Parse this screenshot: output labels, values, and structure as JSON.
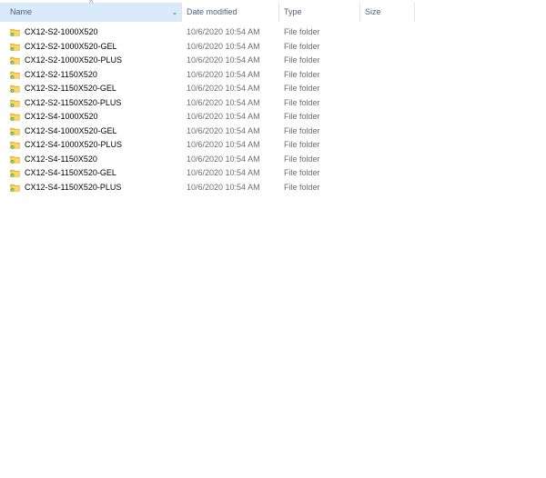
{
  "columns": {
    "name": "Name",
    "date_modified": "Date modified",
    "type": "Type",
    "size": "Size"
  },
  "icons": {
    "sort": "sort-up-icon",
    "dropdown": "chevron-down-icon",
    "folder": "folder-sync-icon"
  },
  "colors": {
    "header_selected_bg": "#d9ebf9",
    "folder_yellow": "#f3c54b",
    "sync_green": "#55b23a"
  },
  "files": [
    {
      "name": "CX12-S2-1000X520",
      "date": "10/6/2020 10:54 AM",
      "type": "File folder",
      "size": ""
    },
    {
      "name": "CX12-S2-1000X520-GEL",
      "date": "10/6/2020 10:54 AM",
      "type": "File folder",
      "size": ""
    },
    {
      "name": "CX12-S2-1000X520-PLUS",
      "date": "10/6/2020 10:54 AM",
      "type": "File folder",
      "size": ""
    },
    {
      "name": "CX12-S2-1150X520",
      "date": "10/6/2020 10:54 AM",
      "type": "File folder",
      "size": ""
    },
    {
      "name": "CX12-S2-1150X520-GEL",
      "date": "10/6/2020 10:54 AM",
      "type": "File folder",
      "size": ""
    },
    {
      "name": "CX12-S2-1150X520-PLUS",
      "date": "10/6/2020 10:54 AM",
      "type": "File folder",
      "size": ""
    },
    {
      "name": "CX12-S4-1000X520",
      "date": "10/6/2020 10:54 AM",
      "type": "File folder",
      "size": ""
    },
    {
      "name": "CX12-S4-1000X520-GEL",
      "date": "10/6/2020 10:54 AM",
      "type": "File folder",
      "size": ""
    },
    {
      "name": "CX12-S4-1000X520-PLUS",
      "date": "10/6/2020 10:54 AM",
      "type": "File folder",
      "size": ""
    },
    {
      "name": "CX12-S4-1150X520",
      "date": "10/6/2020 10:54 AM",
      "type": "File folder",
      "size": ""
    },
    {
      "name": "CX12-S4-1150X520-GEL",
      "date": "10/6/2020 10:54 AM",
      "type": "File folder",
      "size": ""
    },
    {
      "name": "CX12-S4-1150X520-PLUS",
      "date": "10/6/2020 10:54 AM",
      "type": "File folder",
      "size": ""
    }
  ]
}
